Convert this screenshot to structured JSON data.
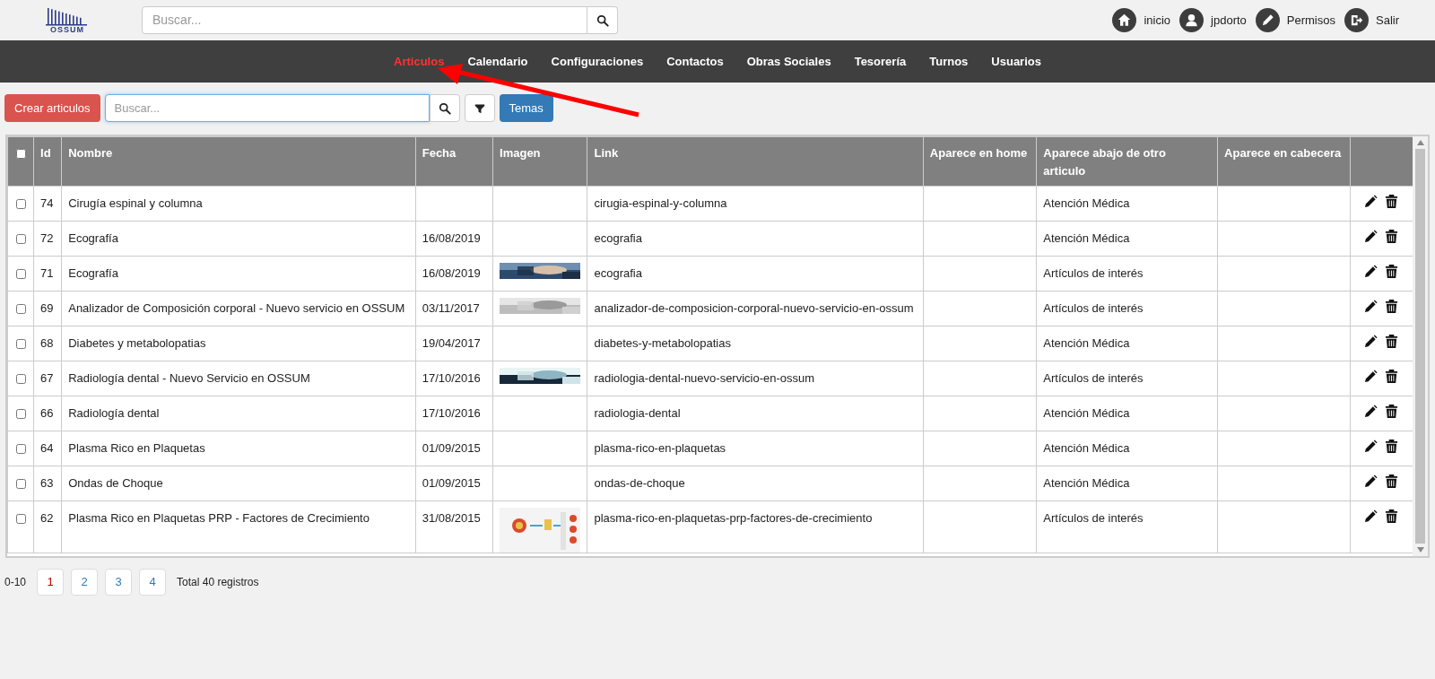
{
  "logo": {
    "text": "OSSUM"
  },
  "search": {
    "placeholder": "Buscar..."
  },
  "user_menu": [
    {
      "kind": "home",
      "label": "inicio"
    },
    {
      "kind": "user",
      "label": "jpdorto"
    },
    {
      "kind": "pencil",
      "label": "Permisos"
    },
    {
      "kind": "exit",
      "label": "Salir"
    }
  ],
  "nav": [
    {
      "label": "Articulos",
      "selected": true
    },
    {
      "label": "Calendario",
      "selected": false
    },
    {
      "label": "Configuraciones",
      "selected": false
    },
    {
      "label": "Contactos",
      "selected": false
    },
    {
      "label": "Obras Sociales",
      "selected": false
    },
    {
      "label": "Tesorería",
      "selected": false
    },
    {
      "label": "Turnos",
      "selected": false
    },
    {
      "label": "Usuarios",
      "selected": false
    }
  ],
  "toolbar": {
    "create_button": "Crear articulos",
    "search_placeholder": "Buscar...",
    "topics_button": "Temas"
  },
  "table": {
    "select_all": {
      "checked": false
    },
    "columns": [
      "Id",
      "Nombre",
      "Fecha",
      "Imagen",
      "Link",
      "Aparece en home",
      "Aparece abajo de otro articulo",
      "Aparece en cabecera"
    ],
    "rows": [
      {
        "checked": false,
        "id": "74",
        "name": "Cirugía espinal y columna",
        "link": "cirugia-espinal-y-columna",
        "below": "Atención Médica"
      },
      {
        "checked": false,
        "id": "72",
        "name": "Ecografía",
        "date": "16/08/2019",
        "link": "ecografia",
        "below": "Atención Médica"
      },
      {
        "checked": false,
        "id": "71",
        "name": "Ecografía",
        "date": "16/08/2019",
        "link": "ecografia",
        "below": "Artículos de interés"
      },
      {
        "checked": false,
        "id": "69",
        "name": "Analizador de Composición corporal - Nuevo servicio en OSSUM",
        "date": "03/11/2017",
        "link": "analizador-de-composicion-corporal-nuevo-servicio-en-ossum",
        "below": "Artículos de interés"
      },
      {
        "checked": false,
        "id": "68",
        "name": "Diabetes y metabolopatias",
        "date": "19/04/2017",
        "link": "diabetes-y-metabolopatias",
        "below": "Atención Médica"
      },
      {
        "checked": false,
        "id": "67",
        "name": "Radiología dental - Nuevo Servicio en OSSUM",
        "date": "17/10/2016",
        "link": "radiologia-dental-nuevo-servicio-en-ossum",
        "below": "Artículos de interés"
      },
      {
        "checked": false,
        "id": "66",
        "name": "Radiología dental",
        "date": "17/10/2016",
        "link": "radiologia-dental",
        "below": "Atención Médica"
      },
      {
        "checked": false,
        "id": "64",
        "name": "Plasma Rico en Plaquetas",
        "date": "01/09/2015",
        "link": "plasma-rico-en-plaquetas",
        "below": "Atención Médica"
      },
      {
        "checked": false,
        "id": "63",
        "name": "Ondas de Choque",
        "date": "01/09/2015",
        "link": "ondas-de-choque",
        "below": "Atención Médica"
      },
      {
        "checked": false,
        "id": "62",
        "name": "Plasma Rico en Plaquetas PRP - Factores de Crecimiento",
        "date": "31/08/2015",
        "link": "plasma-rico-en-plaquetas-prp-factores-de-crecimiento",
        "below": "Artículos de interés"
      }
    ]
  },
  "pagination": {
    "range": "0-10",
    "pages": [
      {
        "label": "1",
        "selected": true
      },
      {
        "label": "2",
        "selected": false
      },
      {
        "label": "3",
        "selected": false
      },
      {
        "label": "4",
        "selected": false
      }
    ],
    "total": "Total 40 registros"
  }
}
